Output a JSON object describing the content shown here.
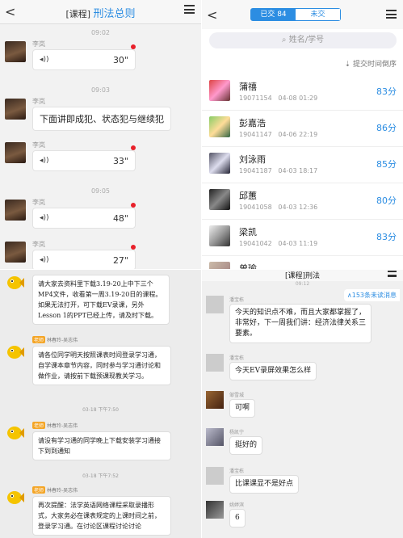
{
  "chat": {
    "back_glyph": "<",
    "title_prefix": "[课程]",
    "title": "刑法总则",
    "menu_icon": "menu-icon",
    "messages": [
      {
        "time": "09:02",
        "name": "李岚",
        "type": "voice",
        "duration": "30\"",
        "unread_dot": true
      },
      {
        "time": "09:03",
        "name": "李岚",
        "type": "text",
        "text": "下面讲即成犯、状态犯与继续犯"
      },
      {
        "time": "",
        "name": "李岚",
        "type": "voice",
        "duration": "33\"",
        "unread_dot": true
      },
      {
        "time": "09:05",
        "name": "李岚",
        "type": "voice",
        "duration": "48\"",
        "unread_dot": true
      },
      {
        "time": "",
        "name": "李岚",
        "type": "voice",
        "duration": "27\"",
        "unread_dot": true
      }
    ],
    "voice_icon": "voice-wave-icon",
    "accent": "#2c8de2",
    "dot_color": "#e8202a"
  },
  "submissions": {
    "tab_done": "已交 84",
    "tab_pending": "未交",
    "search_placeholder": "姓名/学号",
    "sort_label": "提交时间倒序",
    "rows": [
      {
        "name": "蒲禧",
        "id": "19071154",
        "time": "04-08 01:29",
        "score": "83分"
      },
      {
        "name": "彭嘉浩",
        "id": "19041147",
        "time": "04-06 22:19",
        "score": "86分"
      },
      {
        "name": "刘泳雨",
        "id": "19041187",
        "time": "04-03 18:17",
        "score": "85分"
      },
      {
        "name": "邱蕙",
        "id": "19041058",
        "time": "04-03 12:36",
        "score": "80分"
      },
      {
        "name": "梁凯",
        "id": "19041042",
        "time": "04-03 11:19",
        "score": "83分"
      },
      {
        "name": "曾瑜",
        "id": "",
        "time": "",
        "score": ""
      }
    ]
  },
  "group_left": {
    "messages": [
      {
        "ts": "",
        "tag": "",
        "sender": "",
        "text": "请大家去资料里下载3.19-20上中下三个MP4文件，收看第一周3.19-20日的课程。如果无法打开，可下载EV录课，另外Lesson 1的PPT已经上传，请及时下载。"
      },
      {
        "ts": "",
        "tag": "老师",
        "sender": "林春玲-吴志伟",
        "text": "请各位同学明天按照课表时间登录学习通，自学课本章节内容，同时参与学习通讨论和做作业，请按前下载预课现教关学习。"
      },
      {
        "ts": "03-18 下午7:50",
        "tag": "老师",
        "sender": "林春玲-吴志伟",
        "text": "请没有学习通的同学晚上下载安装学习通接下到到通知"
      },
      {
        "ts": "03-18 下午7:52",
        "tag": "老师",
        "sender": "林春玲-吴志伟",
        "text": "再次提醒：法学英语网络课程采取录播形式，大家务必在课表规定的上课时间之前，登录学习通。在讨论区课程讨论讨论"
      }
    ]
  },
  "group_right": {
    "title": "[课程]刑法",
    "ts": "09:12",
    "unread": "∧153条未读消息",
    "messages": [
      {
        "name": "潘宝栋",
        "text": "今天的知识点不难，而且大家都掌握了，非常好，下一周我们讲：经济法律关系三要素。"
      },
      {
        "name": "潘宝栋",
        "text": "今天EV录屏效果怎么样"
      },
      {
        "name": "邹雪城",
        "text": "可啊"
      },
      {
        "name": "杨凯宁",
        "text": "挺好的"
      },
      {
        "name": "潘宝栋",
        "text": "比课课显不是好点"
      },
      {
        "name": "姚婷滨",
        "text": "6"
      }
    ]
  }
}
